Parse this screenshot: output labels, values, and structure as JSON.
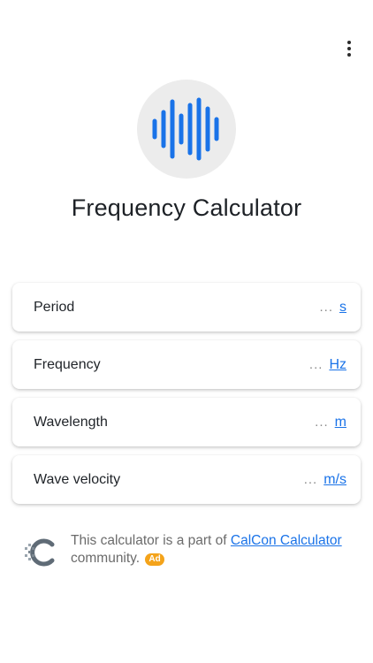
{
  "app": {
    "title": "Frequency Calculator",
    "menu_icon": "more-vertical-icon",
    "hero_icon": "sound-wave-icon",
    "accent_color": "#1a73e8"
  },
  "fields": [
    {
      "label": "Period",
      "placeholder": "...",
      "unit": "s"
    },
    {
      "label": "Frequency",
      "placeholder": "...",
      "unit": "Hz"
    },
    {
      "label": "Wavelength",
      "placeholder": "...",
      "unit": "m"
    },
    {
      "label": "Wave velocity",
      "placeholder": "...",
      "unit": "m/s"
    }
  ],
  "footer": {
    "text_before": "This calculator is a part of ",
    "link_text": "CalCon Calculator",
    "text_after": " community.",
    "ad_label": "Ad",
    "logo_icon": "calcon-logo-icon",
    "ad_color": "#f4a31a"
  }
}
